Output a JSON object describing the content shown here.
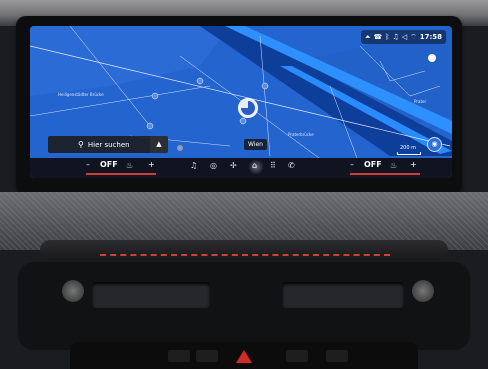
{
  "map": {
    "search_label": "Hier suchen",
    "place_label": "Wien",
    "scale_label": "200 m",
    "time": "17:58",
    "status_icons": [
      "usb-icon",
      "phone-icon",
      "bluetooth-icon",
      "music-icon",
      "volume-icon",
      "wifi-icon"
    ],
    "tiny_labels": [
      "Heiligenstädter Brücke",
      "Praterbrücke",
      "Prater"
    ]
  },
  "climate": {
    "left_minus": "–",
    "left_off": "OFF",
    "left_plus": "+",
    "right_minus": "–",
    "right_off": "OFF",
    "right_plus": "+"
  },
  "menu_icons": [
    "music-icon",
    "navigation-icon",
    "fan-icon",
    "home-icon",
    "apps-grid-icon",
    "phone-icon"
  ],
  "colors": {
    "map_water": "#1f5fc8",
    "map_river": "#0d3e9a",
    "highlight_blue": "#2a8bff",
    "climate_red": "#d23a3a"
  }
}
